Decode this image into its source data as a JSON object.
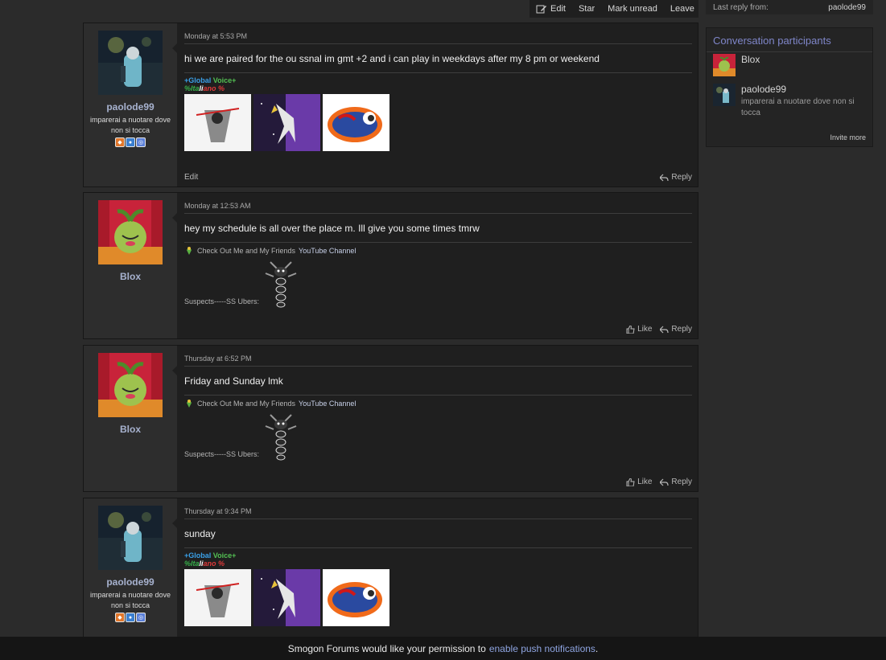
{
  "toolbar": {
    "edit": "Edit",
    "star": "Star",
    "mark_unread": "Mark unread",
    "leave": "Leave"
  },
  "sidebar": {
    "last_reply_label": "Last reply from:",
    "last_reply_user": "paolode99",
    "participants_title": "Conversation participants",
    "participants": [
      {
        "name": "Blox",
        "title": ""
      },
      {
        "name": "paolode99",
        "title": "imparerai a nuotare dove non si tocca"
      }
    ],
    "invite": "Invite more"
  },
  "messages": [
    {
      "date": "Monday at 5:53 PM",
      "user": "paolode99",
      "user_title": "imparerai a nuotare dove non si tocca",
      "text": "hi we are paired for the ou ssnal im gmt +2 and i can play in weekdays after my 8 pm or weekend",
      "sig_line1_a": "+Global",
      "sig_line1_b": "Voice+",
      "sig_line2_a": "%Ita",
      "sig_line2_b": "li",
      "sig_line2_c": "ano %",
      "edit": "Edit",
      "reply": "Reply"
    },
    {
      "date": "Monday at 12:53 AM",
      "user": "Blox",
      "text": "hey my schedule is all over the place m. Ill give you some times tmrw",
      "sig_prefix": "Check Out Me and My Friends",
      "sig_link": "YouTube Channel",
      "suspects": "Suspects-----SS Ubers:",
      "like": "Like",
      "reply": "Reply"
    },
    {
      "date": "Thursday at 6:52 PM",
      "user": "Blox",
      "text": "Friday and Sunday lmk",
      "sig_prefix": "Check Out Me and My Friends",
      "sig_link": "YouTube Channel",
      "suspects": "Suspects-----SS Ubers:",
      "like": "Like",
      "reply": "Reply"
    },
    {
      "date": "Thursday at 9:34 PM",
      "user": "paolode99",
      "user_title": "imparerai a nuotare dove non si tocca",
      "text": "sunday",
      "sig_line1_a": "+Global",
      "sig_line1_b": "Voice+",
      "sig_line2_a": "%Ita",
      "sig_line2_b": "li",
      "sig_line2_c": "ano %"
    }
  ],
  "push": {
    "text": "Smogon Forums would like your permission to",
    "link": "enable push notifications",
    "end": "."
  },
  "colors": {
    "accent": "#7f86c9",
    "background": "#2b2b2b",
    "panel": "#1f1f1f"
  }
}
